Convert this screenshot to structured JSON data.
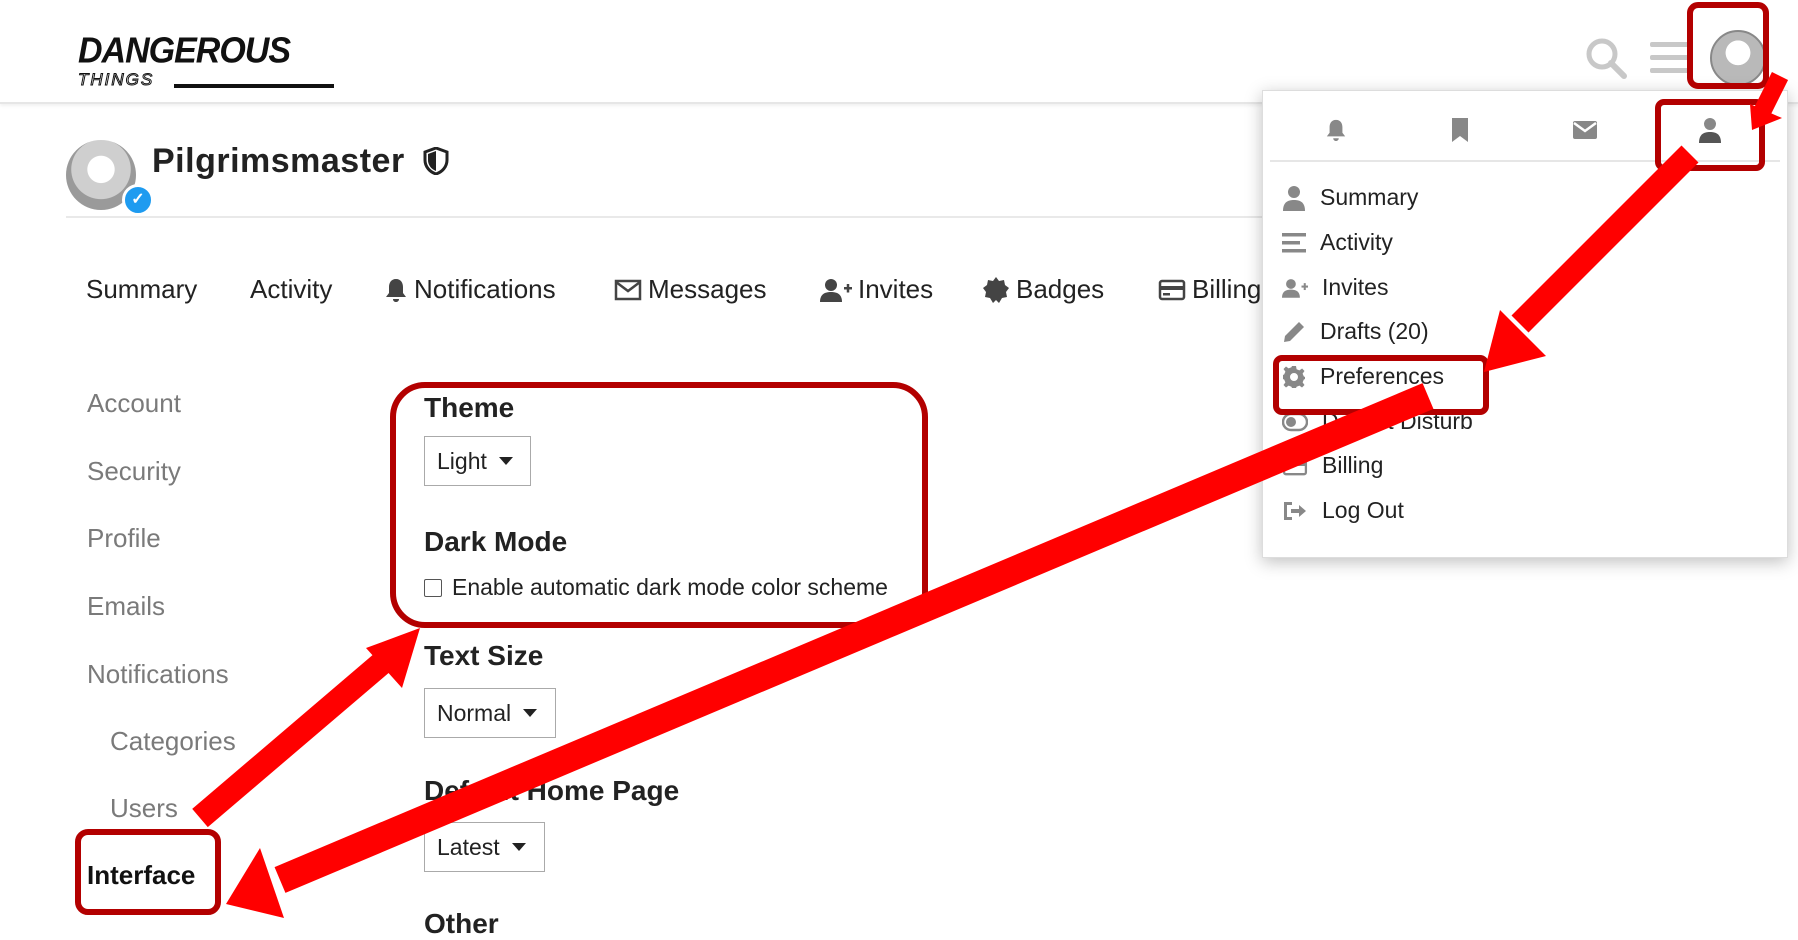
{
  "header": {
    "logo": {
      "main": "DANGEROUS",
      "sub": "THINGS"
    },
    "icons": [
      "search-icon",
      "hamburger-icon",
      "avatar"
    ]
  },
  "profile": {
    "username": "Pilgrimsmaster"
  },
  "nav": {
    "tabs": [
      {
        "label": "Summary",
        "icon": ""
      },
      {
        "label": "Activity",
        "icon": ""
      },
      {
        "label": "Notifications",
        "icon": "bell-icon"
      },
      {
        "label": "Messages",
        "icon": "envelope-icon"
      },
      {
        "label": "Invites",
        "icon": "user-plus-icon"
      },
      {
        "label": "Badges",
        "icon": "badge-icon"
      },
      {
        "label": "Billing",
        "icon": "credit-card-icon"
      }
    ]
  },
  "sidebar": {
    "items": [
      {
        "label": "Account"
      },
      {
        "label": "Security"
      },
      {
        "label": "Profile"
      },
      {
        "label": "Emails"
      },
      {
        "label": "Notifications"
      },
      {
        "label": "Categories"
      },
      {
        "label": "Users"
      },
      {
        "label": "Interface"
      }
    ],
    "active": "Interface"
  },
  "form": {
    "theme": {
      "heading": "Theme",
      "value": "Light"
    },
    "dark_mode": {
      "heading": "Dark Mode",
      "checkbox_label": "Enable automatic dark mode color scheme",
      "checked": false
    },
    "text_size": {
      "heading": "Text Size",
      "value": "Normal"
    },
    "default_home": {
      "heading": "Default Home Page",
      "value": "Latest"
    },
    "other": {
      "heading": "Other"
    }
  },
  "user_menu": {
    "tabs": [
      "bell-icon",
      "bookmark-icon",
      "envelope-icon",
      "user-icon"
    ],
    "active_tab": "user-icon",
    "items": [
      {
        "label": "Summary",
        "icon": "user-icon"
      },
      {
        "label": "Activity",
        "icon": "stream-icon"
      },
      {
        "label": "Invites",
        "icon": "user-plus-icon"
      },
      {
        "label": "Drafts (20)",
        "icon": "pencil-icon"
      },
      {
        "label": "Preferences",
        "icon": "gear-icon"
      },
      {
        "label": "Do Not Disturb",
        "icon": "toggle-icon"
      },
      {
        "label": "Billing",
        "icon": "credit-card-icon"
      },
      {
        "label": "Log Out",
        "icon": "sign-out-icon"
      }
    ]
  },
  "colors": {
    "annotation_red": "#ff0000",
    "annotation_outline": "#b30000",
    "verified_blue": "#1e9bf0"
  }
}
